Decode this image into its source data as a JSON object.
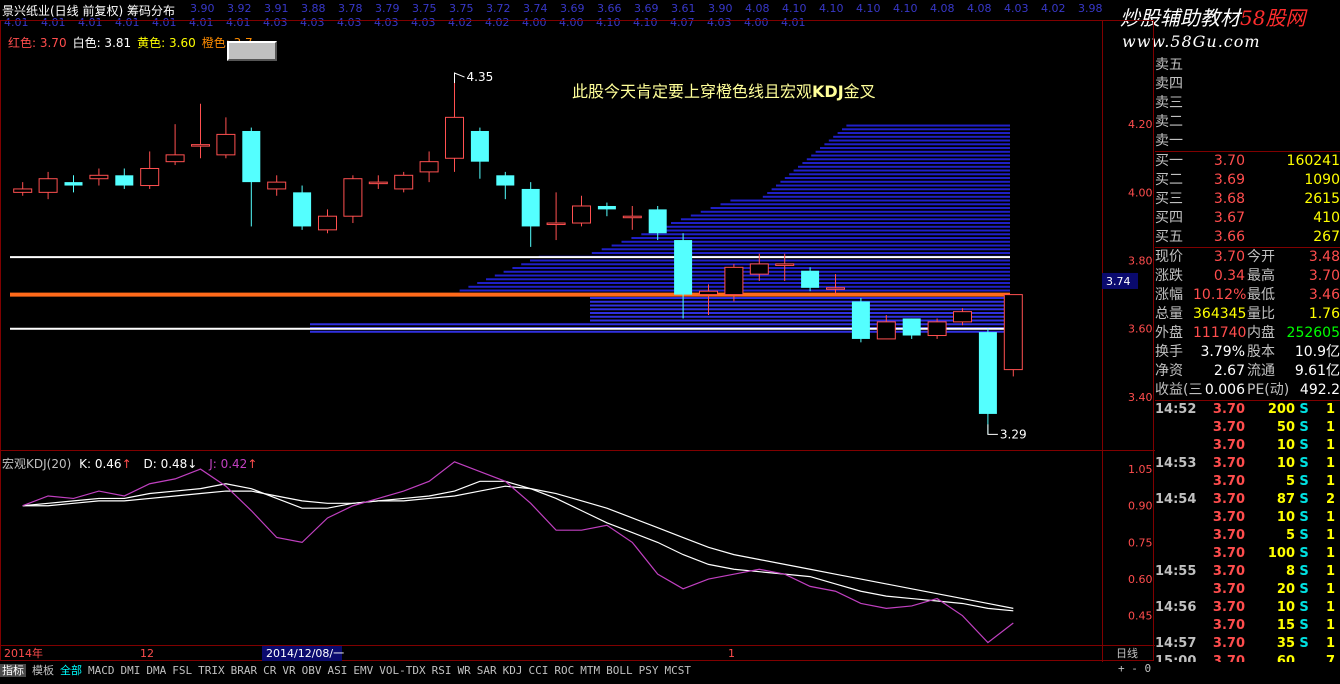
{
  "header": {
    "title": "景兴纸业(日线 前复权) 筹码分布",
    "cost_row_top": [
      "3.90",
      "3.92",
      "3.91",
      "3.88",
      "3.78",
      "3.79",
      "3.75",
      "3.75",
      "3.72",
      "3.74",
      "3.69",
      "3.66",
      "3.69",
      "3.61",
      "3.90",
      "4.08",
      "4.10",
      "4.10",
      "4.10",
      "4.10",
      "4.08",
      "4.08",
      "4.03",
      "4.02",
      "3.98"
    ],
    "cost_row_bottom": [
      "4.01",
      "4.01",
      "4.01",
      "4.01",
      "4.01",
      "4.01",
      "4.01",
      "4.03",
      "4.03",
      "4.03",
      "4.03",
      "4.03",
      "4.02",
      "4.02",
      "4.00",
      "4.00",
      "4.10",
      "4.10",
      "4.07",
      "4.03",
      "4.00",
      "4.01"
    ],
    "legend": [
      {
        "label": "红色: 3.70",
        "color": "#ff4d4d"
      },
      {
        "label": "白色: 3.81",
        "color": "#ffffff"
      },
      {
        "label": "黄色: 3.60",
        "color": "#ffff00"
      },
      {
        "label": "橙色: 3.7",
        "color": "#ff8c00"
      }
    ]
  },
  "annotation": {
    "text": "此股今天肯定要上穿橙色线且宏观",
    "bold": "KDJ",
    "tail": "金叉"
  },
  "watermark": {
    "text_a": "炒股辅助教材",
    "text_b": "58股网",
    "url": "www.58Gu.com"
  },
  "price_axis": {
    "labels": [
      "4.20",
      "4.00",
      "3.80",
      "3.60",
      "3.40"
    ],
    "current": "3.74"
  },
  "price_marks": {
    "high": "4.35",
    "low": "3.29"
  },
  "kdj_axis": {
    "labels": [
      "1.05",
      "0.90",
      "0.75",
      "0.60",
      "0.45"
    ]
  },
  "kdj": {
    "name": "宏观KDJ(20)",
    "k": "K: 0.46",
    "d": "D: 0.48",
    "j": "J: 0.42",
    "k_arrow": "↑",
    "d_arrow": "↓",
    "j_arrow": "↑"
  },
  "date_axis": {
    "year": "2014年",
    "m12": "12",
    "sel": "2014/12/08/一",
    "m1": "1",
    "period": "日线"
  },
  "quote": {
    "sell": [
      {
        "label": "卖五",
        "price": "",
        "vol": ""
      },
      {
        "label": "卖四",
        "price": "",
        "vol": ""
      },
      {
        "label": "卖三",
        "price": "",
        "vol": ""
      },
      {
        "label": "卖二",
        "price": "",
        "vol": ""
      },
      {
        "label": "卖一",
        "price": "",
        "vol": ""
      }
    ],
    "buy": [
      {
        "label": "买一",
        "price": "3.70",
        "vol": "160241"
      },
      {
        "label": "买二",
        "price": "3.69",
        "vol": "1090"
      },
      {
        "label": "买三",
        "price": "3.68",
        "vol": "2615"
      },
      {
        "label": "买四",
        "price": "3.67",
        "vol": "410"
      },
      {
        "label": "买五",
        "price": "3.66",
        "vol": "267"
      }
    ],
    "stats": [
      {
        "l": "现价",
        "a": "3.70",
        "ac": "#ff4d4d",
        "l2": "今开",
        "b": "3.48",
        "bc": "#ff4d4d"
      },
      {
        "l": "涨跌",
        "a": "0.34",
        "ac": "#ff4d4d",
        "l2": "最高",
        "b": "3.70",
        "bc": "#ff4d4d"
      },
      {
        "l": "涨幅",
        "a": "10.12%",
        "ac": "#ff4d4d",
        "l2": "最低",
        "b": "3.46",
        "bc": "#ff4d4d"
      },
      {
        "l": "总量",
        "a": "364345",
        "ac": "#ffff00",
        "l2": "量比",
        "b": "1.76",
        "bc": "#ffff00"
      },
      {
        "l": "外盘",
        "a": "111740",
        "ac": "#ff4d4d",
        "l2": "内盘",
        "b": "252605",
        "bc": "#00ff00"
      },
      {
        "l": "换手",
        "a": "3.79%",
        "ac": "#ffffff",
        "l2": "股本",
        "b": "10.9亿",
        "bc": "#ffffff"
      },
      {
        "l": "净资",
        "a": "2.67",
        "ac": "#ffffff",
        "l2": "流通",
        "b": "9.61亿",
        "bc": "#ffffff"
      },
      {
        "l": "收益(三",
        "a": "0.006",
        "ac": "#ffffff",
        "l2": "PE(动)",
        "b": "492.2",
        "bc": "#ffffff"
      }
    ],
    "ticks": [
      {
        "t": "14:52",
        "p": "3.70",
        "v": "200",
        "s": "S",
        "n": "1"
      },
      {
        "t": "",
        "p": "3.70",
        "v": "50",
        "s": "S",
        "n": "1"
      },
      {
        "t": "",
        "p": "3.70",
        "v": "10",
        "s": "S",
        "n": "1"
      },
      {
        "t": "14:53",
        "p": "3.70",
        "v": "10",
        "s": "S",
        "n": "1"
      },
      {
        "t": "",
        "p": "3.70",
        "v": "5",
        "s": "S",
        "n": "1"
      },
      {
        "t": "14:54",
        "p": "3.70",
        "v": "87",
        "s": "S",
        "n": "2"
      },
      {
        "t": "",
        "p": "3.70",
        "v": "10",
        "s": "S",
        "n": "1"
      },
      {
        "t": "",
        "p": "3.70",
        "v": "5",
        "s": "S",
        "n": "1"
      },
      {
        "t": "",
        "p": "3.70",
        "v": "100",
        "s": "S",
        "n": "1"
      },
      {
        "t": "14:55",
        "p": "3.70",
        "v": "8",
        "s": "S",
        "n": "1"
      },
      {
        "t": "",
        "p": "3.70",
        "v": "20",
        "s": "S",
        "n": "1"
      },
      {
        "t": "14:56",
        "p": "3.70",
        "v": "10",
        "s": "S",
        "n": "1"
      },
      {
        "t": "",
        "p": "3.70",
        "v": "15",
        "s": "S",
        "n": "1"
      },
      {
        "t": "14:57",
        "p": "3.70",
        "v": "35",
        "s": "S",
        "n": "1"
      },
      {
        "t": "15:00",
        "p": "3.70",
        "v": "60",
        "s": "",
        "n": "7"
      }
    ]
  },
  "tabs": [
    "指标",
    "模板",
    "全部",
    "MACD",
    "DMI",
    "DMA",
    "FSL",
    "TRIX",
    "BRAR",
    "CR",
    "VR",
    "OBV",
    "ASI",
    "EMV",
    "VOL-TDX",
    "RSI",
    "WR",
    "SAR",
    "KDJ",
    "CCI",
    "ROC",
    "MTM",
    "BOLL",
    "PSY",
    "MCST"
  ],
  "tab_right": "+ - 0",
  "chart_data": [
    {
      "type": "candlestick",
      "title": "景兴纸业(日线 前复权)",
      "ylim": [
        3.25,
        4.4
      ],
      "yticks": [
        4.2,
        4.0,
        3.8,
        3.6,
        3.4
      ],
      "candles": [
        {
          "o": 4.0,
          "c": 4.01,
          "h": 4.03,
          "l": 3.99
        },
        {
          "o": 4.0,
          "c": 4.04,
          "h": 4.06,
          "l": 3.98
        },
        {
          "o": 4.03,
          "c": 4.02,
          "h": 4.05,
          "l": 4.0
        },
        {
          "o": 4.04,
          "c": 4.05,
          "h": 4.07,
          "l": 4.02
        },
        {
          "o": 4.05,
          "c": 4.02,
          "h": 4.07,
          "l": 4.01
        },
        {
          "o": 4.02,
          "c": 4.07,
          "h": 4.12,
          "l": 4.01
        },
        {
          "o": 4.09,
          "c": 4.11,
          "h": 4.2,
          "l": 4.08
        },
        {
          "o": 4.14,
          "c": 4.14,
          "h": 4.26,
          "l": 4.1
        },
        {
          "o": 4.11,
          "c": 4.17,
          "h": 4.22,
          "l": 4.1
        },
        {
          "o": 4.18,
          "c": 4.03,
          "h": 4.19,
          "l": 3.9
        },
        {
          "o": 4.01,
          "c": 4.03,
          "h": 4.05,
          "l": 3.99
        },
        {
          "o": 4.0,
          "c": 3.9,
          "h": 4.02,
          "l": 3.89
        },
        {
          "o": 3.89,
          "c": 3.93,
          "h": 3.95,
          "l": 3.88
        },
        {
          "o": 3.93,
          "c": 4.04,
          "h": 4.05,
          "l": 3.91
        },
        {
          "o": 4.03,
          "c": 4.03,
          "h": 4.05,
          "l": 4.01
        },
        {
          "o": 4.01,
          "c": 4.05,
          "h": 4.06,
          "l": 4.0
        },
        {
          "o": 4.06,
          "c": 4.09,
          "h": 4.12,
          "l": 4.03
        },
        {
          "o": 4.1,
          "c": 4.22,
          "h": 4.35,
          "l": 4.06
        },
        {
          "o": 4.18,
          "c": 4.09,
          "h": 4.19,
          "l": 4.04
        },
        {
          "o": 4.05,
          "c": 4.02,
          "h": 4.06,
          "l": 3.98
        },
        {
          "o": 4.01,
          "c": 3.9,
          "h": 4.03,
          "l": 3.84
        },
        {
          "o": 3.91,
          "c": 3.91,
          "h": 4.0,
          "l": 3.86
        },
        {
          "o": 3.91,
          "c": 3.96,
          "h": 3.99,
          "l": 3.9
        },
        {
          "o": 3.96,
          "c": 3.95,
          "h": 3.97,
          "l": 3.93
        },
        {
          "o": 3.93,
          "c": 3.93,
          "h": 3.96,
          "l": 3.89
        },
        {
          "o": 3.95,
          "c": 3.88,
          "h": 3.96,
          "l": 3.86
        },
        {
          "o": 3.86,
          "c": 3.7,
          "h": 3.88,
          "l": 3.63
        },
        {
          "o": 3.7,
          "c": 3.71,
          "h": 3.73,
          "l": 3.64
        },
        {
          "o": 3.7,
          "c": 3.78,
          "h": 3.79,
          "l": 3.68
        },
        {
          "o": 3.76,
          "c": 3.79,
          "h": 3.82,
          "l": 3.74
        },
        {
          "o": 3.79,
          "c": 3.79,
          "h": 3.82,
          "l": 3.74
        },
        {
          "o": 3.77,
          "c": 3.72,
          "h": 3.78,
          "l": 3.71
        },
        {
          "o": 3.72,
          "c": 3.72,
          "h": 3.76,
          "l": 3.7
        },
        {
          "o": 3.68,
          "c": 3.57,
          "h": 3.69,
          "l": 3.56
        },
        {
          "o": 3.57,
          "c": 3.62,
          "h": 3.64,
          "l": 3.57
        },
        {
          "o": 3.63,
          "c": 3.58,
          "h": 3.63,
          "l": 3.57
        },
        {
          "o": 3.58,
          "c": 3.62,
          "h": 3.63,
          "l": 3.57
        },
        {
          "o": 3.62,
          "c": 3.65,
          "h": 3.66,
          "l": 3.61
        },
        {
          "o": 3.59,
          "c": 3.35,
          "h": 3.6,
          "l": 3.29
        },
        {
          "o": 3.48,
          "c": 3.7,
          "h": 3.7,
          "l": 3.46
        }
      ],
      "lines": [
        {
          "name": "白色",
          "value": 3.81,
          "color": "#ffffff"
        },
        {
          "name": "橙色",
          "value": 3.7,
          "color": "#ff6a1a"
        },
        {
          "name": "黄色",
          "value": 3.6,
          "color": "#ffffff"
        }
      ]
    },
    {
      "type": "line",
      "title": "宏观KDJ(20)",
      "ylim": [
        0.33,
        1.12
      ],
      "yticks": [
        1.05,
        0.9,
        0.75,
        0.6,
        0.45
      ],
      "series": [
        {
          "name": "K",
          "color": "#ffffff",
          "values": [
            0.9,
            0.91,
            0.92,
            0.93,
            0.93,
            0.95,
            0.96,
            0.97,
            0.99,
            0.97,
            0.93,
            0.89,
            0.89,
            0.91,
            0.92,
            0.93,
            0.94,
            0.96,
            1.0,
            1.0,
            0.97,
            0.93,
            0.88,
            0.83,
            0.79,
            0.75,
            0.7,
            0.66,
            0.64,
            0.63,
            0.62,
            0.61,
            0.58,
            0.55,
            0.53,
            0.52,
            0.51,
            0.5,
            0.48,
            0.47
          ]
        },
        {
          "name": "D",
          "color": "#ffffff",
          "values": [
            0.9,
            0.9,
            0.91,
            0.92,
            0.92,
            0.93,
            0.94,
            0.95,
            0.96,
            0.96,
            0.94,
            0.92,
            0.91,
            0.91,
            0.92,
            0.92,
            0.93,
            0.94,
            0.96,
            0.98,
            0.97,
            0.95,
            0.92,
            0.89,
            0.85,
            0.81,
            0.77,
            0.73,
            0.7,
            0.68,
            0.66,
            0.64,
            0.62,
            0.6,
            0.58,
            0.56,
            0.54,
            0.52,
            0.5,
            0.48
          ]
        },
        {
          "name": "J",
          "color": "#c040c0",
          "values": [
            0.9,
            0.94,
            0.93,
            0.96,
            0.94,
            0.99,
            1.01,
            1.05,
            0.98,
            0.88,
            0.77,
            0.75,
            0.85,
            0.9,
            0.93,
            0.96,
            1.0,
            1.08,
            1.04,
            1.0,
            0.91,
            0.8,
            0.8,
            0.82,
            0.75,
            0.62,
            0.56,
            0.6,
            0.62,
            0.64,
            0.62,
            0.57,
            0.55,
            0.5,
            0.48,
            0.49,
            0.52,
            0.45,
            0.34,
            0.42
          ]
        }
      ]
    }
  ]
}
